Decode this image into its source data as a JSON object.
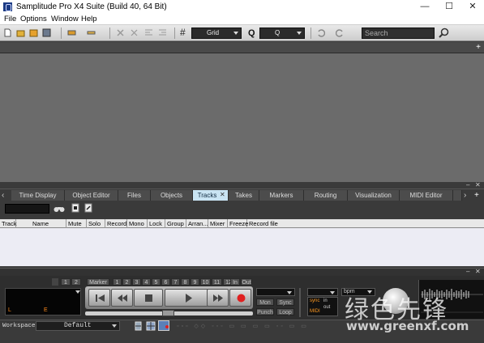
{
  "window": {
    "title": "Samplitude Pro X4 Suite (Build 40, 64 Bit)",
    "minimize": "—",
    "maximize": "☐",
    "close": "✕"
  },
  "menu": [
    "File",
    "Options",
    "Window",
    "Help"
  ],
  "toolbar": {
    "grid_value": "Grid",
    "quantize_value": "Q",
    "search_placeholder": "Search"
  },
  "tabs": [
    "Time Display",
    "Object Editor",
    "Files",
    "Objects",
    "Tracks",
    "Takes",
    "Markers",
    "Routing",
    "Visualization",
    "MIDI Editor"
  ],
  "active_tab": "Tracks",
  "track_columns": [
    "Track",
    "Name",
    "Mute",
    "Solo",
    "Record",
    "Mono",
    "Lock",
    "Group",
    "Arran...",
    "Mixer",
    "Freeze",
    "Record file"
  ],
  "transport": {
    "marker_keys": [
      "1",
      "2",
      "Marker",
      "1",
      "2",
      "3",
      "4",
      "5",
      "6",
      "7",
      "8",
      "9",
      "10",
      "11",
      "12",
      "In",
      "Out"
    ],
    "time_left": "L",
    "time_e": "E",
    "mon": "Mon",
    "sync": "Sync",
    "punch": "Punch",
    "loop": "Loop",
    "bpm": "bpm",
    "sync_box": {
      "sync": "sync",
      "in": "in",
      "out": "out",
      "midi": "MIDI"
    }
  },
  "status": {
    "workspace_label": "Workspace:",
    "workspace_value": "Default"
  },
  "watermark": {
    "cn": "绿色先锋",
    "url": "www.greenxf.com"
  },
  "colors": {
    "active_tab": "#c9e4f3",
    "record": "#e02020"
  }
}
